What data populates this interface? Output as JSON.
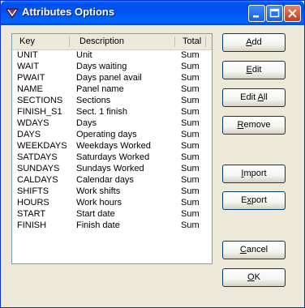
{
  "window": {
    "title": "Attributes Options"
  },
  "list": {
    "columns": [
      "Key",
      "Description",
      "Total"
    ],
    "rows": [
      {
        "key": "UNIT",
        "description": "Unit",
        "total": "Sum"
      },
      {
        "key": "WAIT",
        "description": "Days waiting",
        "total": "Sum"
      },
      {
        "key": "PWAIT",
        "description": "Days panel avail",
        "total": "Sum"
      },
      {
        "key": "NAME",
        "description": "Panel name",
        "total": "Sum"
      },
      {
        "key": "SECTIONS",
        "description": "Sections",
        "total": "Sum"
      },
      {
        "key": "FINISH_S1",
        "description": "Sect. 1 finish",
        "total": "Sum"
      },
      {
        "key": "WDAYS",
        "description": "Days",
        "total": "Sum"
      },
      {
        "key": "DAYS",
        "description": "Operating days",
        "total": "Sum"
      },
      {
        "key": "WEEKDAYS",
        "description": "Weekdays Worked",
        "total": "Sum"
      },
      {
        "key": "SATDAYS",
        "description": "Saturdays Worked",
        "total": "Sum"
      },
      {
        "key": "SUNDAYS",
        "description": "Sundays Worked",
        "total": "Sum"
      },
      {
        "key": "CALDAYS",
        "description": "Calendar days",
        "total": "Sum"
      },
      {
        "key": "SHIFTS",
        "description": "Work shifts",
        "total": "Sum"
      },
      {
        "key": "HOURS",
        "description": "Work hours",
        "total": "Sum"
      },
      {
        "key": "START",
        "description": "Start date",
        "total": "Sum"
      },
      {
        "key": "FINISH",
        "description": "Finish date",
        "total": "Sum"
      }
    ]
  },
  "buttons": {
    "add": {
      "pre": "",
      "ul": "A",
      "post": "dd"
    },
    "edit": {
      "pre": "",
      "ul": "E",
      "post": "dit"
    },
    "edit_all": {
      "pre": "Edit ",
      "ul": "A",
      "post": "ll"
    },
    "remove": {
      "pre": "",
      "ul": "R",
      "post": "emove"
    },
    "import": {
      "pre": "",
      "ul": "I",
      "post": "mport"
    },
    "export": {
      "pre": "E",
      "ul": "x",
      "post": "port"
    },
    "cancel": {
      "pre": "",
      "ul": "C",
      "post": "ancel"
    },
    "ok": {
      "pre": "",
      "ul": "O",
      "post": "K"
    }
  }
}
